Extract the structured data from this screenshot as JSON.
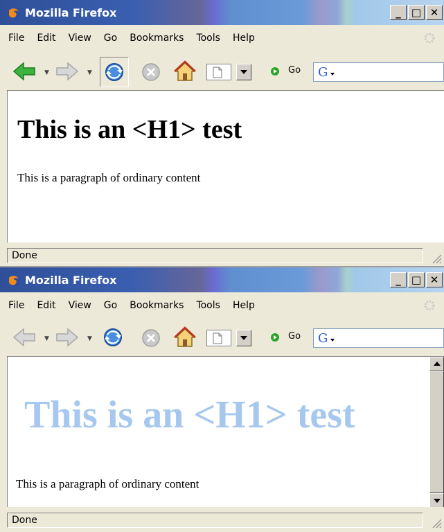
{
  "windows": [
    {
      "title": "Mozilla Firefox",
      "menu": [
        "File",
        "Edit",
        "View",
        "Go",
        "Bookmarks",
        "Tools",
        "Help"
      ],
      "go_label": "Go",
      "heading": "This is an <H1> test",
      "heading_color": "#000000",
      "paragraph": "This is a paragraph of ordinary content",
      "status": "Done",
      "scrollbar": false,
      "back_enabled": true
    },
    {
      "title": "Mozilla Firefox",
      "menu": [
        "File",
        "Edit",
        "View",
        "Go",
        "Bookmarks",
        "Tools",
        "Help"
      ],
      "go_label": "Go",
      "heading": "This is an <H1> test",
      "heading_color": "#a6c8ee",
      "paragraph": "This is a paragraph of ordinary content",
      "status": "Done",
      "scrollbar": true,
      "back_enabled": false
    }
  ],
  "colors": {
    "back_arrow_active": "#3cb33c",
    "disabled_arrow": "#c8c8c8",
    "go_green": "#2aa52a"
  }
}
